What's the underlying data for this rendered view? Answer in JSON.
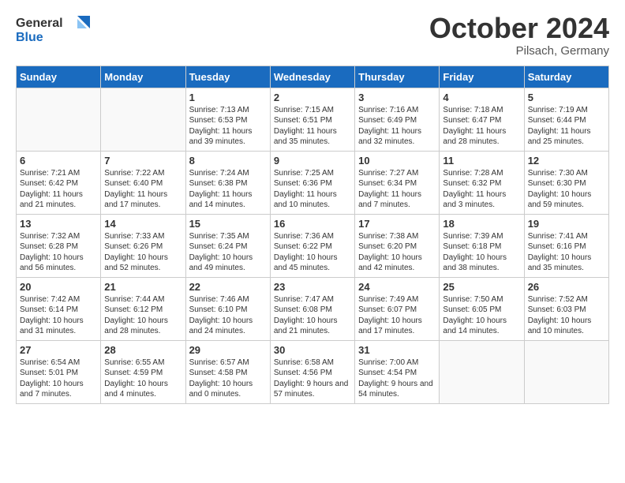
{
  "header": {
    "logo_line1": "General",
    "logo_line2": "Blue",
    "month": "October 2024",
    "location": "Pilsach, Germany"
  },
  "days": [
    "Sunday",
    "Monday",
    "Tuesday",
    "Wednesday",
    "Thursday",
    "Friday",
    "Saturday"
  ],
  "weeks": [
    [
      {
        "date": "",
        "info": ""
      },
      {
        "date": "",
        "info": ""
      },
      {
        "date": "1",
        "info": "Sunrise: 7:13 AM\nSunset: 6:53 PM\nDaylight: 11 hours and 39 minutes."
      },
      {
        "date": "2",
        "info": "Sunrise: 7:15 AM\nSunset: 6:51 PM\nDaylight: 11 hours and 35 minutes."
      },
      {
        "date": "3",
        "info": "Sunrise: 7:16 AM\nSunset: 6:49 PM\nDaylight: 11 hours and 32 minutes."
      },
      {
        "date": "4",
        "info": "Sunrise: 7:18 AM\nSunset: 6:47 PM\nDaylight: 11 hours and 28 minutes."
      },
      {
        "date": "5",
        "info": "Sunrise: 7:19 AM\nSunset: 6:44 PM\nDaylight: 11 hours and 25 minutes."
      }
    ],
    [
      {
        "date": "6",
        "info": "Sunrise: 7:21 AM\nSunset: 6:42 PM\nDaylight: 11 hours and 21 minutes."
      },
      {
        "date": "7",
        "info": "Sunrise: 7:22 AM\nSunset: 6:40 PM\nDaylight: 11 hours and 17 minutes."
      },
      {
        "date": "8",
        "info": "Sunrise: 7:24 AM\nSunset: 6:38 PM\nDaylight: 11 hours and 14 minutes."
      },
      {
        "date": "9",
        "info": "Sunrise: 7:25 AM\nSunset: 6:36 PM\nDaylight: 11 hours and 10 minutes."
      },
      {
        "date": "10",
        "info": "Sunrise: 7:27 AM\nSunset: 6:34 PM\nDaylight: 11 hours and 7 minutes."
      },
      {
        "date": "11",
        "info": "Sunrise: 7:28 AM\nSunset: 6:32 PM\nDaylight: 11 hours and 3 minutes."
      },
      {
        "date": "12",
        "info": "Sunrise: 7:30 AM\nSunset: 6:30 PM\nDaylight: 10 hours and 59 minutes."
      }
    ],
    [
      {
        "date": "13",
        "info": "Sunrise: 7:32 AM\nSunset: 6:28 PM\nDaylight: 10 hours and 56 minutes."
      },
      {
        "date": "14",
        "info": "Sunrise: 7:33 AM\nSunset: 6:26 PM\nDaylight: 10 hours and 52 minutes."
      },
      {
        "date": "15",
        "info": "Sunrise: 7:35 AM\nSunset: 6:24 PM\nDaylight: 10 hours and 49 minutes."
      },
      {
        "date": "16",
        "info": "Sunrise: 7:36 AM\nSunset: 6:22 PM\nDaylight: 10 hours and 45 minutes."
      },
      {
        "date": "17",
        "info": "Sunrise: 7:38 AM\nSunset: 6:20 PM\nDaylight: 10 hours and 42 minutes."
      },
      {
        "date": "18",
        "info": "Sunrise: 7:39 AM\nSunset: 6:18 PM\nDaylight: 10 hours and 38 minutes."
      },
      {
        "date": "19",
        "info": "Sunrise: 7:41 AM\nSunset: 6:16 PM\nDaylight: 10 hours and 35 minutes."
      }
    ],
    [
      {
        "date": "20",
        "info": "Sunrise: 7:42 AM\nSunset: 6:14 PM\nDaylight: 10 hours and 31 minutes."
      },
      {
        "date": "21",
        "info": "Sunrise: 7:44 AM\nSunset: 6:12 PM\nDaylight: 10 hours and 28 minutes."
      },
      {
        "date": "22",
        "info": "Sunrise: 7:46 AM\nSunset: 6:10 PM\nDaylight: 10 hours and 24 minutes."
      },
      {
        "date": "23",
        "info": "Sunrise: 7:47 AM\nSunset: 6:08 PM\nDaylight: 10 hours and 21 minutes."
      },
      {
        "date": "24",
        "info": "Sunrise: 7:49 AM\nSunset: 6:07 PM\nDaylight: 10 hours and 17 minutes."
      },
      {
        "date": "25",
        "info": "Sunrise: 7:50 AM\nSunset: 6:05 PM\nDaylight: 10 hours and 14 minutes."
      },
      {
        "date": "26",
        "info": "Sunrise: 7:52 AM\nSunset: 6:03 PM\nDaylight: 10 hours and 10 minutes."
      }
    ],
    [
      {
        "date": "27",
        "info": "Sunrise: 6:54 AM\nSunset: 5:01 PM\nDaylight: 10 hours and 7 minutes."
      },
      {
        "date": "28",
        "info": "Sunrise: 6:55 AM\nSunset: 4:59 PM\nDaylight: 10 hours and 4 minutes."
      },
      {
        "date": "29",
        "info": "Sunrise: 6:57 AM\nSunset: 4:58 PM\nDaylight: 10 hours and 0 minutes."
      },
      {
        "date": "30",
        "info": "Sunrise: 6:58 AM\nSunset: 4:56 PM\nDaylight: 9 hours and 57 minutes."
      },
      {
        "date": "31",
        "info": "Sunrise: 7:00 AM\nSunset: 4:54 PM\nDaylight: 9 hours and 54 minutes."
      },
      {
        "date": "",
        "info": ""
      },
      {
        "date": "",
        "info": ""
      }
    ]
  ]
}
